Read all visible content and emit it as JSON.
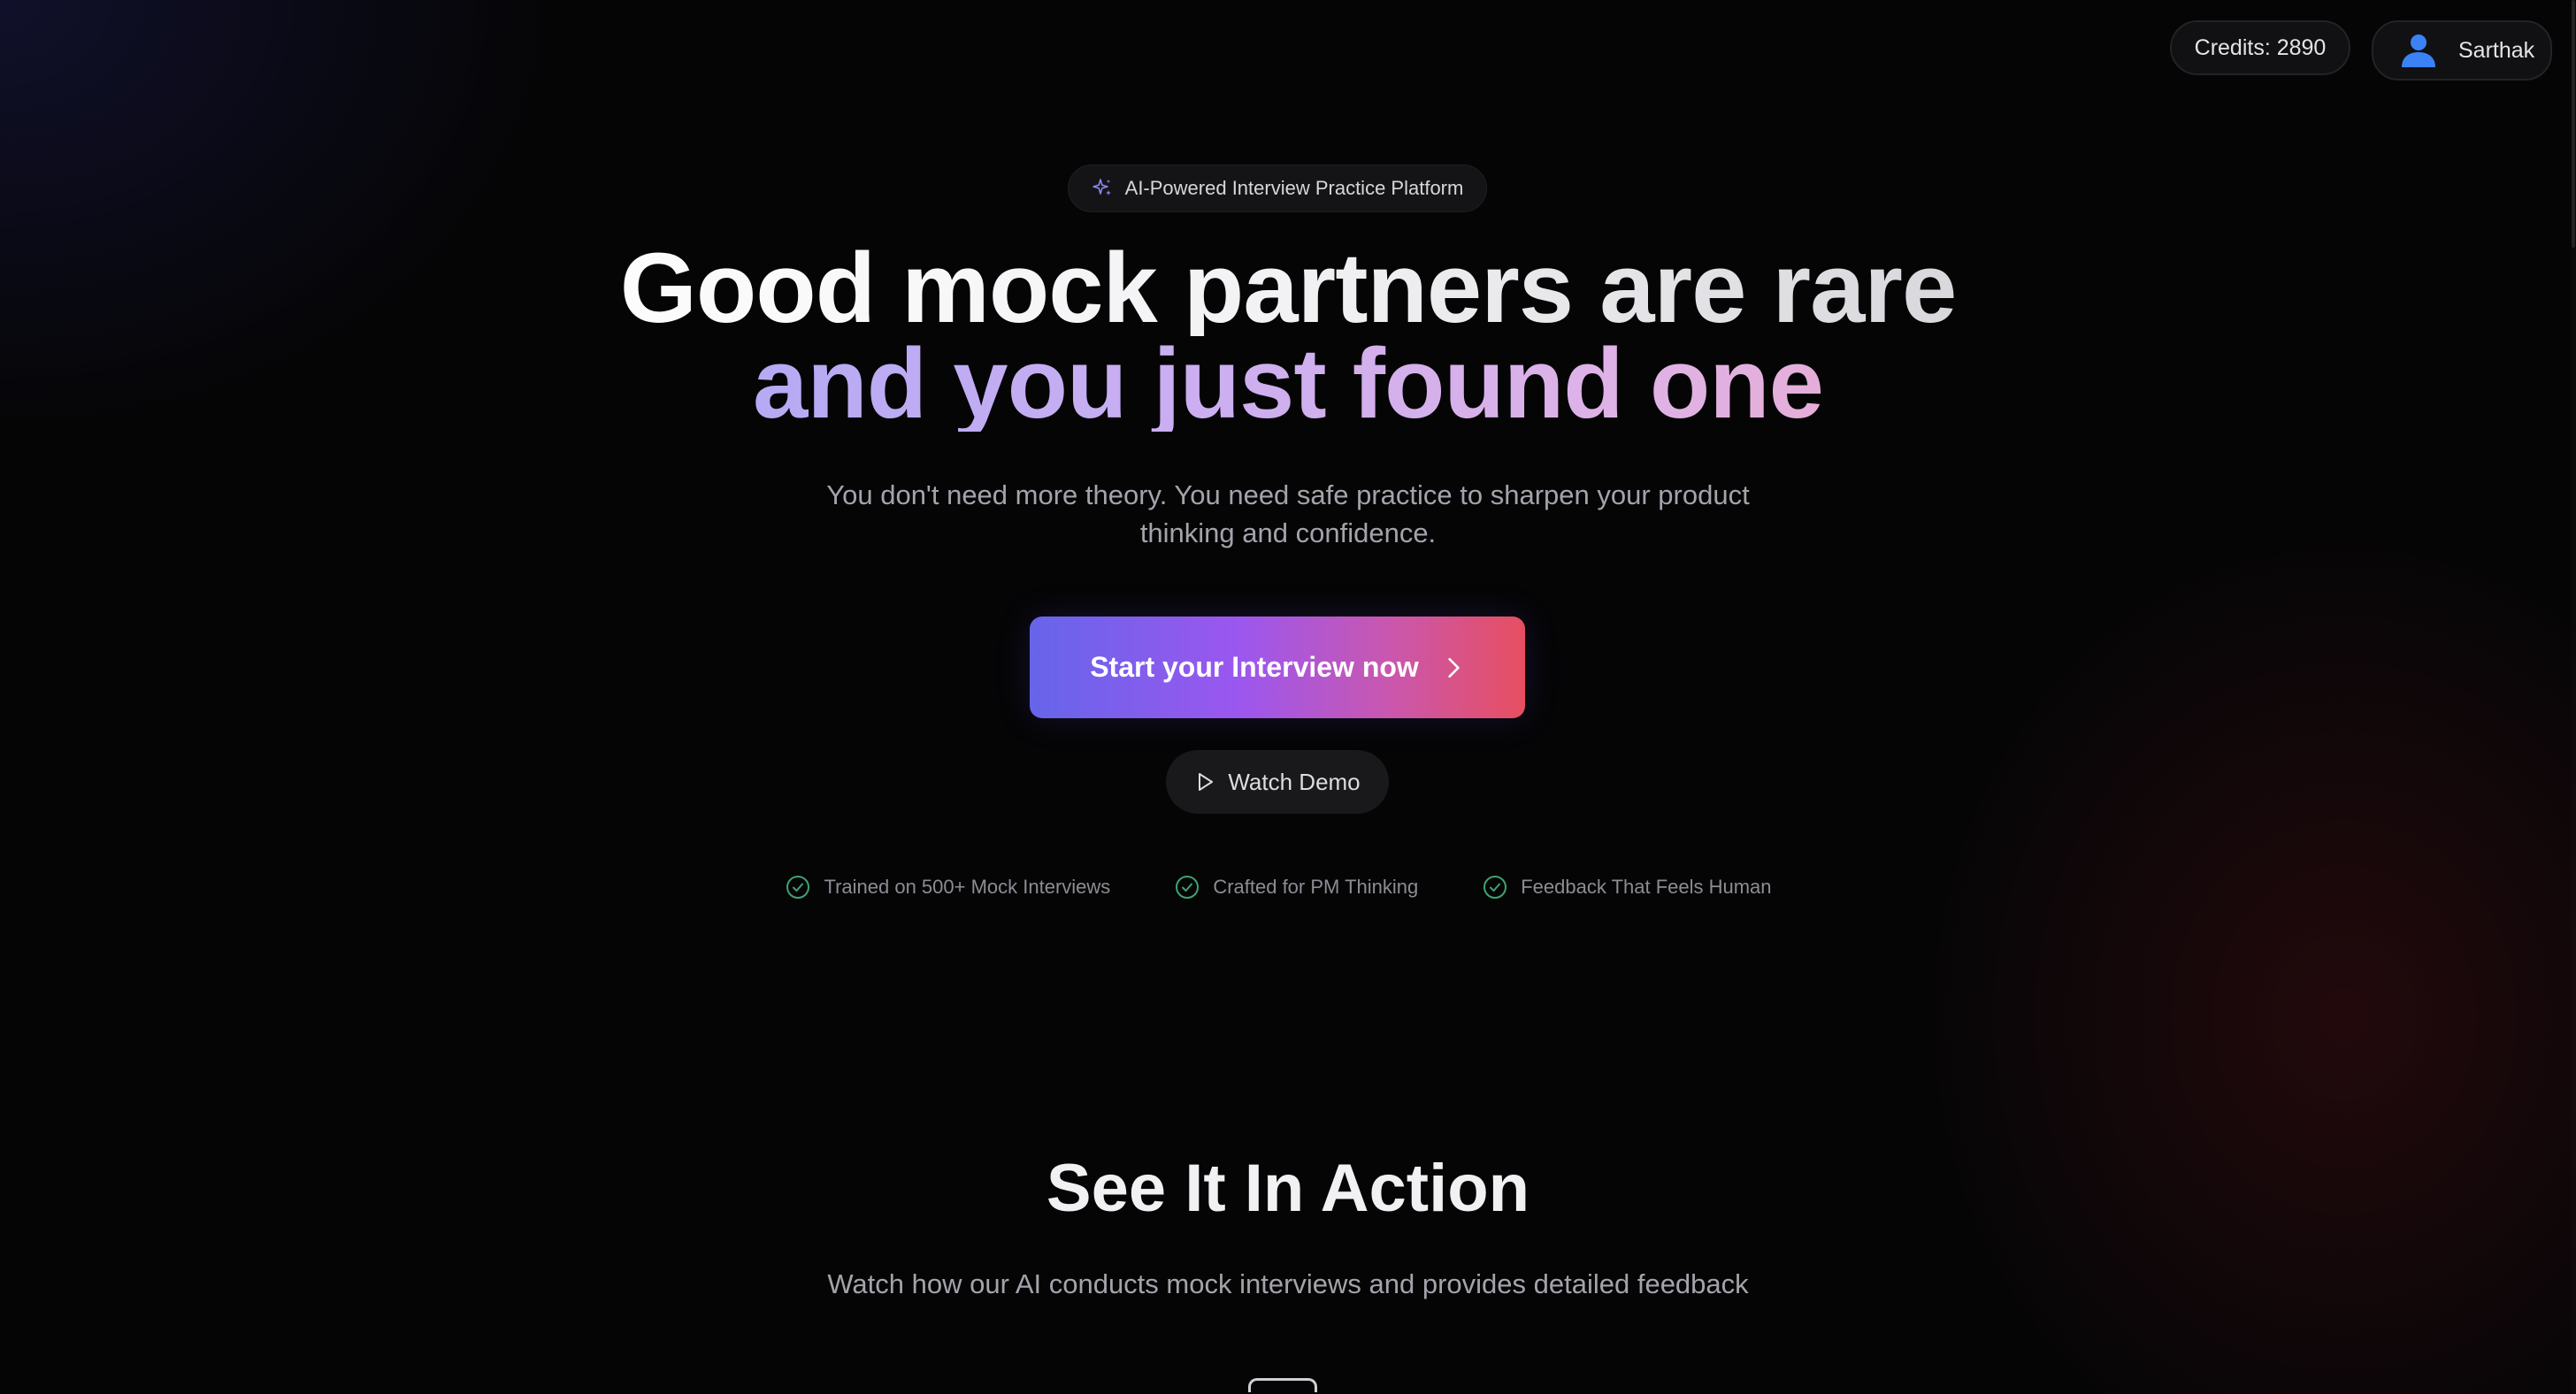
{
  "nav": {
    "credits_label": "Credits: 2890",
    "user_name": "Sarthak"
  },
  "hero": {
    "badge_text": "AI-Powered Interview Practice Platform",
    "headline_line1": "Good mock partners are rare",
    "headline_line2": "and you just found one",
    "subtitle": "You don't need more theory. You need safe practice to sharpen your product thinking and confidence.",
    "cta_label": "Start your Interview now",
    "demo_label": "Watch Demo",
    "features": [
      "Trained on 500+ Mock Interviews",
      "Crafted for PM Thinking",
      "Feedback That Feels Human"
    ]
  },
  "demo_section": {
    "title": "See It In Action",
    "subtitle": "Watch how our AI conducts mock interviews and provides detailed feedback"
  },
  "colors": {
    "background": "#050506",
    "cta_gradient_start": "#6665ea",
    "cta_gradient_mid": "#9b57ef",
    "cta_gradient_end": "#e74f60",
    "check_icon": "#3fa272",
    "badge_icon": "#8b87f0",
    "avatar": "#3b82f6"
  },
  "icons": {
    "badge": "sparkles-icon",
    "cta": "chevron-right-icon",
    "demo": "play-icon",
    "feature": "check-circle-icon",
    "user": "user-avatar-icon"
  }
}
